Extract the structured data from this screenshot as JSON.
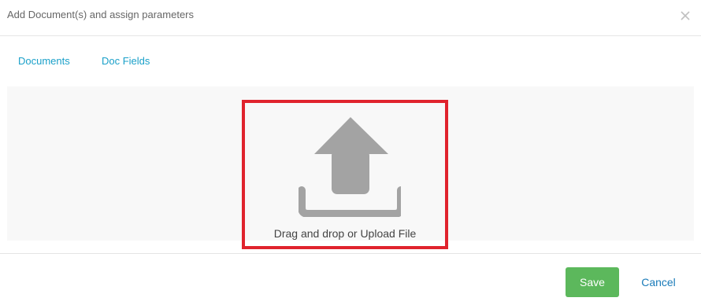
{
  "dialog": {
    "title": "Add Document(s) and assign parameters",
    "close_icon": "close-icon"
  },
  "tabs": [
    {
      "label": "Documents"
    },
    {
      "label": "Doc Fields"
    }
  ],
  "upload": {
    "icon": "upload-icon",
    "label": "Drag and drop or Upload File"
  },
  "footer": {
    "save_label": "Save",
    "cancel_label": "Cancel"
  },
  "colors": {
    "link": "#1aa0c9",
    "save_button": "#5cb85c",
    "highlight_border": "#e0232d",
    "icon_gray": "#a3a3a3"
  }
}
